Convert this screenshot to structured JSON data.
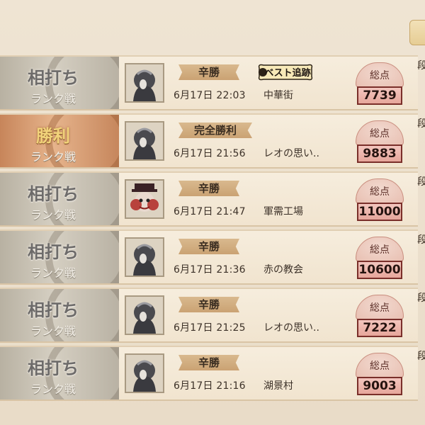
{
  "rows": [
    {
      "result": "相打ち",
      "mode": "ランク戦",
      "win": false,
      "mood": "辛勝",
      "date": "6月17日 22:03",
      "map": "中華街",
      "score_label": "総点",
      "score": "7739",
      "award": "ベスト追跡",
      "portrait": "hooded-hunter-icon",
      "rank_cut": "段"
    },
    {
      "result": "勝利",
      "mode": "ランク戦",
      "win": true,
      "mood": "完全勝利",
      "date": "6月17日 21:56",
      "map": "レオの思い..",
      "score_label": "総点",
      "score": "9883",
      "award": "",
      "portrait": "hooded-hunter-icon",
      "rank_cut": "段"
    },
    {
      "result": "相打ち",
      "mode": "ランク戦",
      "win": false,
      "mood": "辛勝",
      "date": "6月17日 21:47",
      "map": "軍需工場",
      "score_label": "総点",
      "score": "11000",
      "award": "",
      "portrait": "clown-hunter-icon",
      "rank_cut": "段"
    },
    {
      "result": "相打ち",
      "mode": "ランク戦",
      "win": false,
      "mood": "辛勝",
      "date": "6月17日 21:36",
      "map": "赤の教会",
      "score_label": "総点",
      "score": "10600",
      "award": "",
      "portrait": "hooded-hunter-icon",
      "rank_cut": "段"
    },
    {
      "result": "相打ち",
      "mode": "ランク戦",
      "win": false,
      "mood": "辛勝",
      "date": "6月17日 21:25",
      "map": "レオの思い..",
      "score_label": "総点",
      "score": "7222",
      "award": "",
      "portrait": "hooded-hunter-icon",
      "rank_cut": "段"
    },
    {
      "result": "相打ち",
      "mode": "ランク戦",
      "win": false,
      "mood": "辛勝",
      "date": "6月17日 21:16",
      "map": "湖景村",
      "score_label": "総点",
      "score": "9003",
      "award": "",
      "portrait": "hooded-hunter-icon",
      "rank_cut": "段"
    }
  ]
}
